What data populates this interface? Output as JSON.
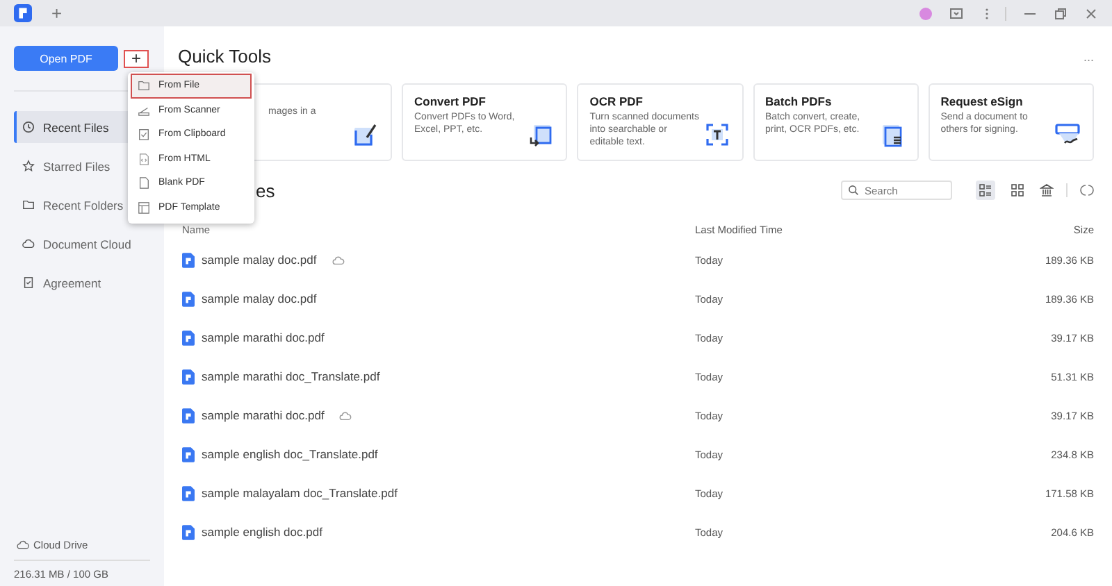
{
  "title_bar": {
    "new_tab": "+"
  },
  "sidebar": {
    "open_button": "Open PDF",
    "new_button": "+",
    "items": [
      {
        "label": "Recent Files",
        "selected": true
      },
      {
        "label": "Starred Files",
        "selected": false
      },
      {
        "label": "Recent Folders",
        "selected": false
      },
      {
        "label": "Document Cloud",
        "selected": false
      },
      {
        "label": "Agreement",
        "selected": false
      }
    ],
    "cloud_drive": "Cloud Drive",
    "storage": "216.31 MB / 100 GB"
  },
  "new_menu": [
    {
      "label": "From File",
      "selected": true
    },
    {
      "label": "From Scanner",
      "selected": false
    },
    {
      "label": "From Clipboard",
      "selected": false
    },
    {
      "label": "From HTML",
      "selected": false
    },
    {
      "label": "Blank PDF",
      "selected": false
    },
    {
      "label": "PDF Template",
      "selected": false
    }
  ],
  "quick_tools": {
    "title": "Quick Tools",
    "more": "...",
    "cards": [
      {
        "description": "mages in a"
      },
      {
        "title": "Convert PDF",
        "description": "Convert PDFs to Word, Excel, PPT, etc."
      },
      {
        "title": "OCR PDF",
        "description": "Turn scanned documents into searchable or editable text."
      },
      {
        "title": "Batch PDFs",
        "description": "Batch convert, create, print, OCR PDFs, etc."
      },
      {
        "title": "Request eSign",
        "description": "Send a document to others for signing."
      }
    ]
  },
  "files": {
    "heading": "es",
    "search": {
      "placeholder": "Search"
    },
    "views": [
      {
        "selected": true
      },
      {
        "selected": false
      }
    ],
    "columns": [
      "Name",
      "Last Modified Time",
      "Size"
    ],
    "rows": [
      {
        "name": "sample malay doc.pdf",
        "cloud": true,
        "time": "Today",
        "size": "189.36 KB"
      },
      {
        "name": "sample malay doc.pdf",
        "cloud": false,
        "time": "Today",
        "size": "189.36 KB"
      },
      {
        "name": "sample marathi doc.pdf",
        "cloud": false,
        "time": "Today",
        "size": "39.17 KB"
      },
      {
        "name": "sample marathi doc_Translate.pdf",
        "cloud": false,
        "time": "Today",
        "size": "51.31 KB"
      },
      {
        "name": "sample marathi doc.pdf",
        "cloud": true,
        "time": "Today",
        "size": "39.17 KB"
      },
      {
        "name": "sample english doc_Translate.pdf",
        "cloud": false,
        "time": "Today",
        "size": "234.8 KB"
      },
      {
        "name": "sample malayalam doc_Translate.pdf",
        "cloud": false,
        "time": "Today",
        "size": "171.58 KB"
      },
      {
        "name": "sample english doc.pdf",
        "cloud": false,
        "time": "Today",
        "size": "204.6 KB"
      }
    ]
  }
}
